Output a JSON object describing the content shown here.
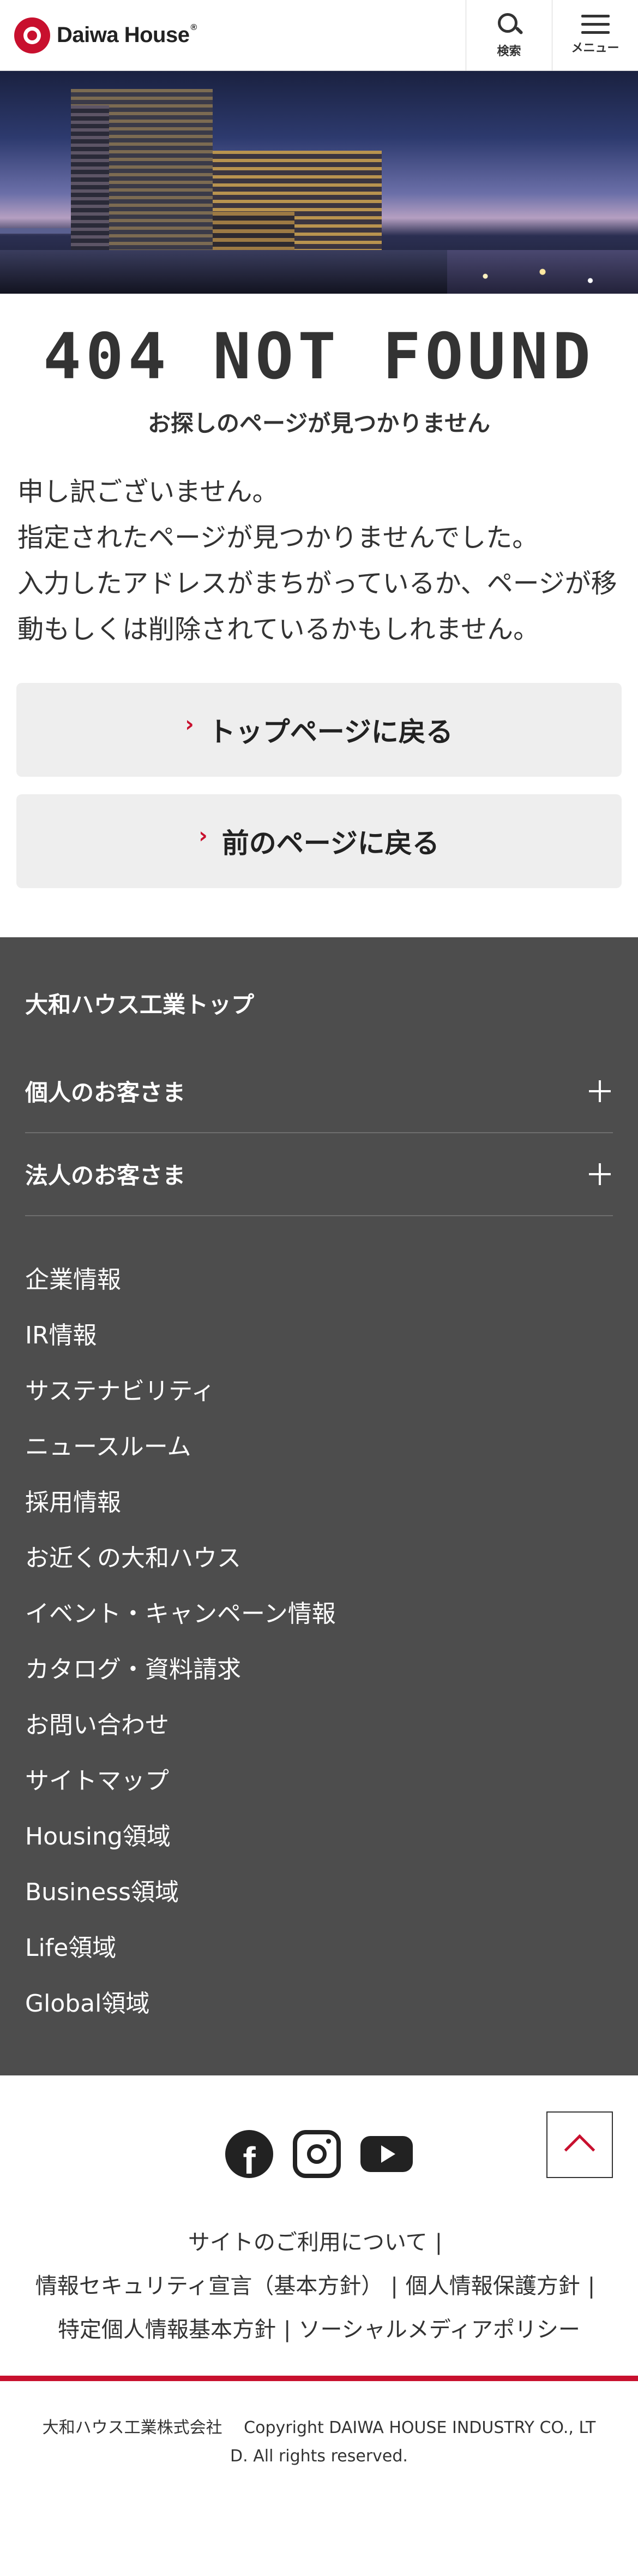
{
  "header": {
    "logo_text": "Daiwa House",
    "logo_mark": "®",
    "search_label": "検索",
    "menu_label": "メニュー"
  },
  "error": {
    "title": "404 NOT FOUND",
    "subtitle": "お探しのページが見つかりません",
    "message_lines": [
      "申し訳ございません。",
      "指定されたページが見つかりませんでした。",
      "入力したアドレスがまちがっているか、ページが移",
      "動もしくは削除されているかもしれません。"
    ]
  },
  "buttons": {
    "top_page": "トップページに戻る",
    "prev_page": "前のページに戻る"
  },
  "footer_nav": {
    "top_link": "大和ハウス工業トップ",
    "accordions": [
      "個人のお客さま",
      "法人のお客さま"
    ],
    "links": [
      "企業情報",
      "IR情報",
      "サステナビリティ",
      "ニュースルーム",
      "採用情報",
      "お近くの大和ハウス",
      "イベント・キャンペーン情報",
      "カタログ・資料請求",
      "お問い合わせ",
      "サイトマップ",
      "Housing領域",
      "Business領域",
      "Life領域",
      "Global領域"
    ]
  },
  "social": {
    "icons": [
      "facebook-icon",
      "instagram-icon",
      "youtube-icon"
    ],
    "facebook_glyph": "f"
  },
  "policy_links": {
    "site_use": "サイトのご利用について",
    "security": "情報セキュリティ宣言（基本方針）",
    "privacy": "個人情報保護方針",
    "specific_privacy": "特定個人情報基本方針",
    "social_media": "ソーシャルメディアポリシー",
    "separator": "|"
  },
  "copyright": {
    "company": "大和ハウス工業株式会社",
    "text_1": "Copyright DAIWA HOUSE INDUSTRY CO., LT",
    "text_2": "D. All rights reserved."
  },
  "colors": {
    "brand_red": "#c8102e",
    "footer_bg": "#4d4d4d",
    "button_bg": "#eeeeee"
  }
}
